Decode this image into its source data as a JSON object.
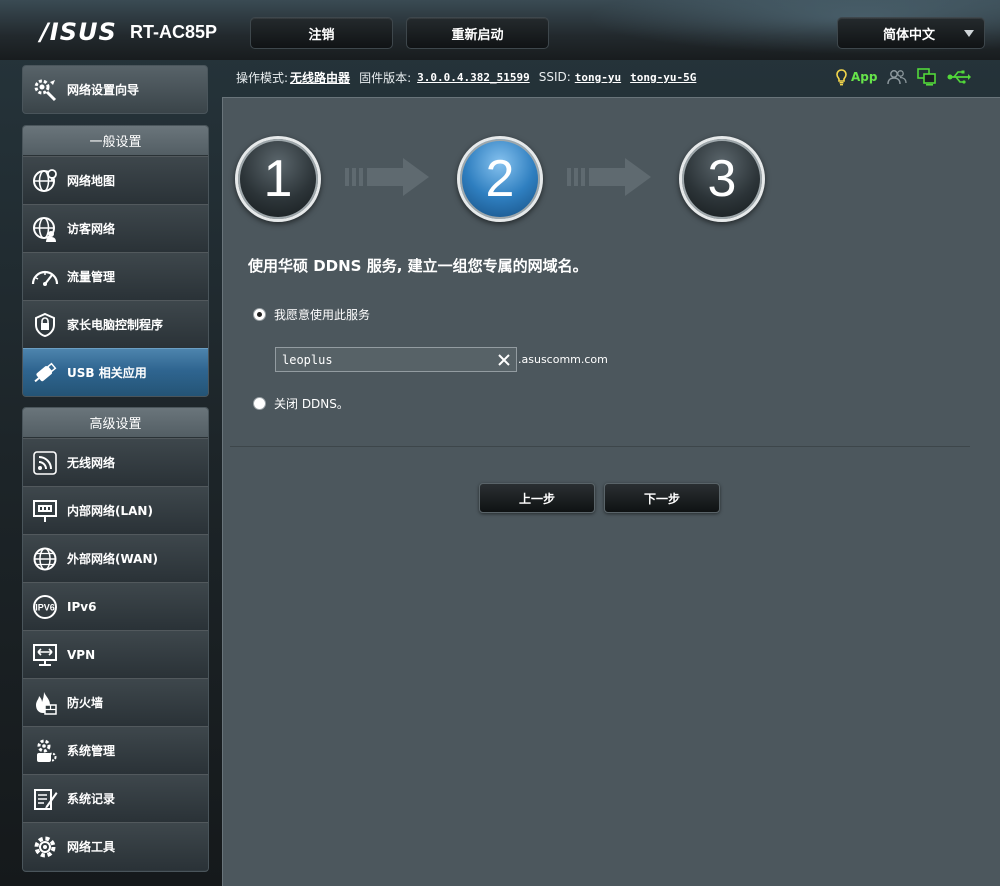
{
  "header": {
    "brand": "/ISUS",
    "model": "RT-AC85P",
    "logout": "注销",
    "reboot": "重新启动",
    "language": "简体中文"
  },
  "infobar": {
    "mode_label": "操作模式:",
    "mode_value": "无线路由器",
    "firmware_label": "固件版本:",
    "firmware_value": "3.0.0.4.382_51599",
    "ssid_label": "SSID:",
    "ssid_1": "tong-yu",
    "ssid_2": "tong-yu-5G",
    "app_label": "App"
  },
  "sidebar": {
    "quick_setup": "网络设置向导",
    "general_title": "一般设置",
    "general_items": [
      {
        "label": "网络地图",
        "icon": "network-map-icon"
      },
      {
        "label": "访客网络",
        "icon": "guest-network-icon"
      },
      {
        "label": "流量管理",
        "icon": "traffic-manager-icon"
      },
      {
        "label": "家长电脑控制程序",
        "icon": "parental-control-icon"
      },
      {
        "label": "USB 相关应用",
        "icon": "usb-application-icon"
      }
    ],
    "advanced_title": "高级设置",
    "advanced_items": [
      {
        "label": "无线网络",
        "icon": "wireless-icon"
      },
      {
        "label": "内部网络(LAN)",
        "icon": "lan-icon"
      },
      {
        "label": "外部网络(WAN)",
        "icon": "wan-icon"
      },
      {
        "label": "IPv6",
        "icon": "ipv6-icon"
      },
      {
        "label": "VPN",
        "icon": "vpn-icon"
      },
      {
        "label": "防火墙",
        "icon": "firewall-icon"
      },
      {
        "label": "系统管理",
        "icon": "administration-icon"
      },
      {
        "label": "系统记录",
        "icon": "system-log-icon"
      },
      {
        "label": "网络工具",
        "icon": "network-tools-icon"
      }
    ]
  },
  "wizard": {
    "steps": [
      "1",
      "2",
      "3"
    ],
    "active_step": 2,
    "description": "使用华硕 DDNS 服务, 建立一组您专属的网域名。",
    "option_enable": "我愿意使用此服务",
    "hostname_value": "leoplus",
    "domain_suffix": ".asuscomm.com",
    "option_disable": "关闭 DDNS。",
    "prev_button": "上一步",
    "next_button": "下一步"
  },
  "colors": {
    "accent_blue": "#2f6590",
    "app_green": "#66e34a",
    "main_bg": "#4c575d"
  }
}
